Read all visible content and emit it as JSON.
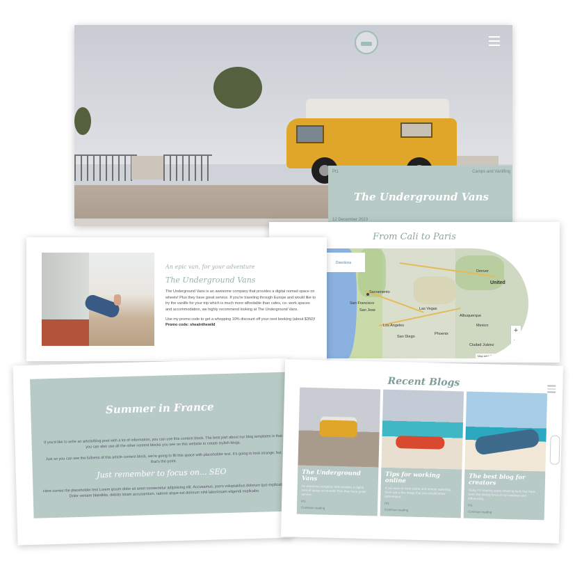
{
  "hero": {
    "category_left": "Pt1",
    "category_right": "Camps and Vanlifing",
    "title": "The Underground Vans",
    "date": "12 December 2023"
  },
  "map": {
    "title": "From Cali to Paris",
    "popup_label": "Directions",
    "zoom_in": "+",
    "zoom_out": "−",
    "attribution": "Map data ©2023 Google · Terms of use",
    "cities": [
      "Sacramento",
      "San Francisco",
      "San Jose",
      "Las Vegas",
      "Los Angeles",
      "San Diego",
      "Phoenix",
      "Albuquerque",
      "Ciudad Juárez",
      "United",
      "Mexico",
      "Denver"
    ]
  },
  "about": {
    "tagline": "An epic van, for your adventure",
    "heading": "The Underground Vans",
    "body": "The Underground Vans is an awesome company that provides a digital nomad space on wheels! Plus they have great service. If you're traveling through Europe and would like to try the vanlife for your trip which is much more affordable than cafes, co- work spaces and accommodation, we highly recommend looking at The Underground Vans.",
    "promo_text": "Use my promo code to get a whopping 10% discount off your next booking (about $350)!",
    "promo_code": "Promo code: shealnthewild"
  },
  "summer": {
    "title": "Summer in France",
    "para1": "If you'd like to write an article/blog post with a lot of information, you can use this content block. The best part about our blog templates is that you can also use all the other content blocks you see on this website to create stylish blogs.",
    "para2": "Just so you can see the fullness of this article content block, we're going to fill this space with placeholder text. It's going to look strange, but that's the point.",
    "quote": "Just remember to focus on... SEO",
    "para3": "Here comes the placeholder text Lorem ipsum dolor sit amet consectetur adipisicing elit. Accusamus, porro voluptatibus dolorum quo explicabo. Dolor veniam blanditiis, debitis totam accusantium, ratione atque est dolorum nihil laboriosam eligendi explicabo."
  },
  "blogs": {
    "title": "Recent Blogs",
    "posts": [
      {
        "title": "The Underground Vans",
        "excerpt": "An awesome company that provides a digital nomad space on wheels! Plus they have great service.",
        "date": "Pt1",
        "more": "Continue reading"
      },
      {
        "title": "Tips for working online",
        "excerpt": "If you want to work online and remote travelling, there are a few things that you should know beforehand.",
        "date": "Pt1",
        "more": "Continue reading"
      },
      {
        "title": "The best blog for creators",
        "excerpt": "Today I'm sharing some amazing tools that have been the driving force of my business and influencing.",
        "date": "Pt1",
        "more": "Continue reading"
      }
    ]
  }
}
